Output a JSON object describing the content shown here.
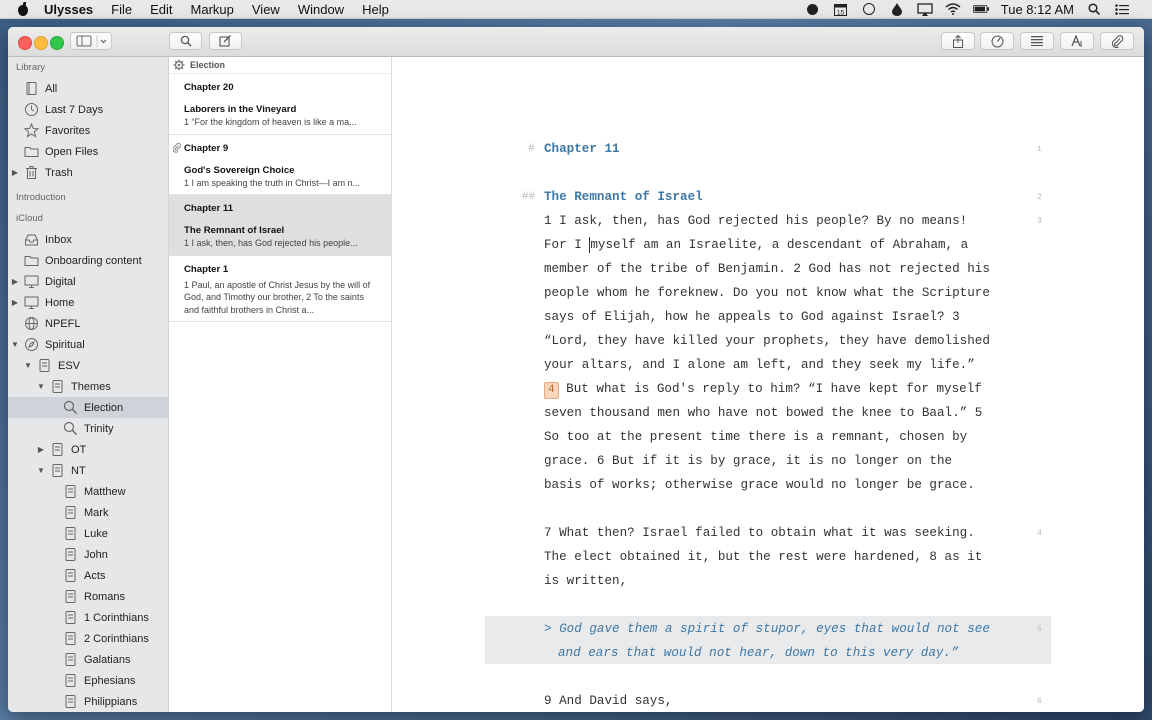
{
  "menubar": {
    "app": "Ulysses",
    "items": [
      "File",
      "Edit",
      "Markup",
      "View",
      "Window",
      "Help"
    ],
    "clock": "Tue 8:12 AM",
    "calendar_day": "15"
  },
  "library": {
    "sections": {
      "library": "Library",
      "introduction": "Introduction",
      "icloud": "iCloud"
    },
    "items": [
      {
        "label": "All"
      },
      {
        "label": "Last 7 Days"
      },
      {
        "label": "Favorites"
      },
      {
        "label": "Open Files"
      },
      {
        "label": "Trash"
      },
      {
        "label": "Inbox"
      },
      {
        "label": "Onboarding content"
      },
      {
        "label": "Digital"
      },
      {
        "label": "Home"
      },
      {
        "label": "NPEFL"
      },
      {
        "label": "Spiritual"
      },
      {
        "label": "ESV"
      },
      {
        "label": "Themes"
      },
      {
        "label": "Election"
      },
      {
        "label": "Trinity"
      },
      {
        "label": "OT"
      },
      {
        "label": "NT"
      },
      {
        "label": "Matthew"
      },
      {
        "label": "Mark"
      },
      {
        "label": "Luke"
      },
      {
        "label": "John"
      },
      {
        "label": "Acts"
      },
      {
        "label": "Romans"
      },
      {
        "label": "1 Corinthians"
      },
      {
        "label": "2 Corinthians"
      },
      {
        "label": "Galatians"
      },
      {
        "label": "Ephesians"
      },
      {
        "label": "Philippians"
      }
    ]
  },
  "sheets": {
    "group": "Election",
    "items": [
      {
        "heading": "Chapter 20",
        "title": "Laborers in the Vineyard",
        "preview": "1 “For the kingdom of heaven is like a ma..."
      },
      {
        "heading": "Chapter 9",
        "title": "God's Sovereign Choice",
        "preview": "1 I am speaking the truth in Christ—I am n..."
      },
      {
        "heading": "Chapter 11",
        "title": "The Remnant of Israel",
        "preview": "1 I ask, then, has God rejected his people..."
      },
      {
        "heading": "Chapter 1",
        "title": "",
        "preview": "1 Paul, an apostle of Christ Jesus by the will of God, and Timothy our brother, 2 To the saints and faithful brothers in Christ a..."
      }
    ]
  },
  "editor": {
    "h1_mark": "#",
    "h1": "Chapter 11",
    "h2_mark": "##",
    "h2": "The Remnant of Israel",
    "p1a": "1 I ask, then, has God rejected his people? By no means! For I ",
    "p1b": "myself am an Israelite, a descendant of Abraham, a member of the tribe of Benjamin. 2 God has not rejected his people whom he foreknew. Do you not know what the Scripture says of Elijah, how he appeals to God against Israel? 3 “Lord, they have killed your prophets, they have demolished your altars, and I alone am left, and they seek my life.” ",
    "footnote": "4",
    "p1c": " But what is God's reply to him? “I have kept for myself seven thousand men who have not bowed the knee to Baal.” 5 So too at the present time there is a remnant, chosen by grace. 6 But if it is by grace, it is no longer on the basis of works; otherwise grace would no longer be grace.",
    "p2": "7 What then? Israel failed to obtain what it was seeking. The elect obtained it, but the rest were hardened, 8 as it is written,",
    "quote": "> God gave them a spirit of stupor, eyes that would not see and ears that would not hear, down to this very day.”",
    "p3": "9 And David says,",
    "line_numbers": [
      "1",
      "2",
      "3",
      "4",
      "5",
      "6"
    ]
  }
}
